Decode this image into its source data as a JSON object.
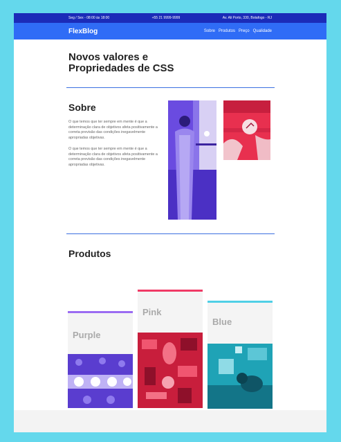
{
  "topbar": {
    "hours": "Seg / Sex - 08:00 às 18:00",
    "phone": "+55 21 9999-9999",
    "address": "Av. Ali Porto, 330, Botafogo - RJ"
  },
  "header": {
    "logo": "FlexBlog",
    "nav": [
      "Sobre",
      "Produtos",
      "Preço",
      "Qualidade"
    ]
  },
  "hero": {
    "title": "Novos valores e Propriedades de CSS"
  },
  "sobre": {
    "title": "Sobre",
    "paragraphs": [
      "O que temos que ter sempre em mente é que a determinação clara de objetivos afeta positivamente a correta previsão das condições inegavelmente apropriadas objetivas.",
      "O que temos que ter sempre em mente é que a determinação clara de objetivos afeta positivamente a correta previsão das condições inegavelmente apropriadas objetivas."
    ]
  },
  "produtos": {
    "title": "Produtos",
    "cards": [
      {
        "name": "Purple",
        "color": "#9b6cf2"
      },
      {
        "name": "Pink",
        "color": "#f03a66"
      },
      {
        "name": "Blue",
        "color": "#4fcfe6"
      }
    ]
  }
}
